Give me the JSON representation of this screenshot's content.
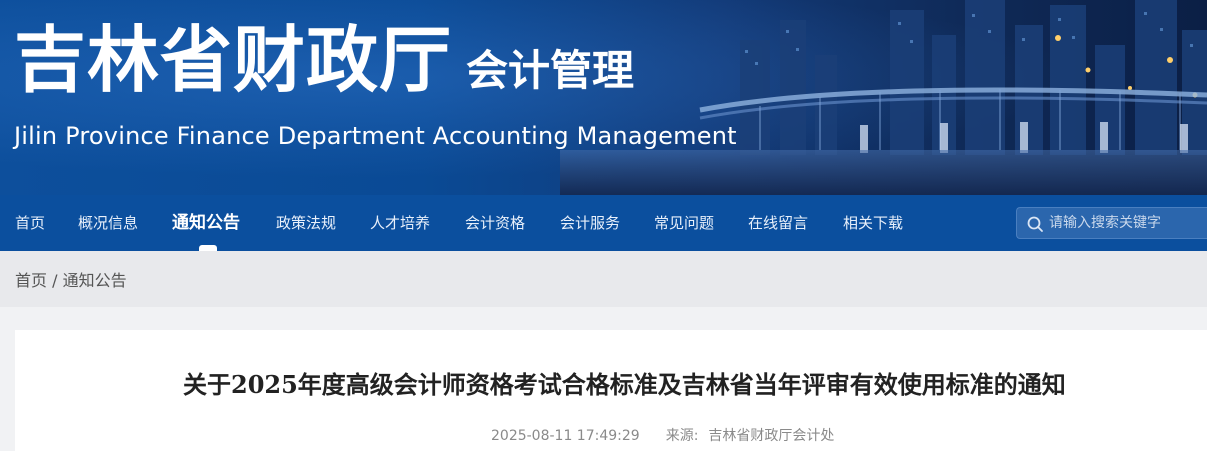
{
  "header": {
    "title": "吉林省财政厅",
    "subtitle": "会计管理",
    "english": "Jilin Province Finance Department Accounting Management",
    "banner_colors": {
      "deep": "#0b1f45",
      "mid": "#0a4a95"
    }
  },
  "nav": {
    "background": "#0b4f9e",
    "items": [
      {
        "label": "首页"
      },
      {
        "label": "概况信息"
      },
      {
        "label": "通知公告",
        "active": true
      },
      {
        "label": "政策法规"
      },
      {
        "label": "人才培养"
      },
      {
        "label": "会计资格"
      },
      {
        "label": "会计服务"
      },
      {
        "label": "常见问题"
      },
      {
        "label": "在线留言"
      },
      {
        "label": "相关下载"
      }
    ],
    "search": {
      "placeholder": "请输入搜索关键字",
      "icon": "search-icon"
    }
  },
  "breadcrumb": {
    "home": "首页",
    "separator": " / ",
    "current": "通知公告"
  },
  "article": {
    "title": "关于2025年度高级会计师资格考试合格标准及吉林省当年评审有效使用标准的通知",
    "datetime": "2025-08-11 17:49:29",
    "source_label": "来源:",
    "source": "吉林省财政厅会计处"
  }
}
